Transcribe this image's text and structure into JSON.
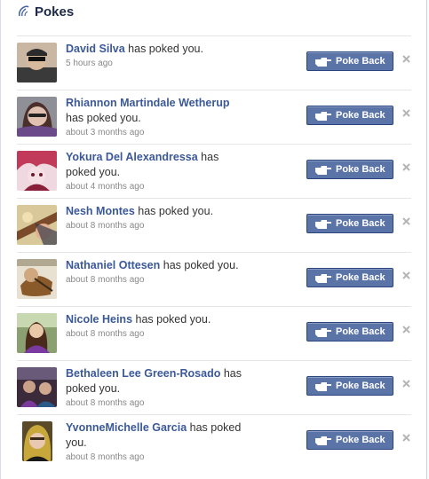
{
  "header": {
    "title": "Pokes",
    "icon": "poke-finger-icon"
  },
  "pokes": [
    {
      "name": "David Silva",
      "action": " has poked you.",
      "time": "5 hours ago",
      "button": "Poke Back"
    },
    {
      "name": "Rhiannon Martindale Wetherup",
      "action": " has poked you.",
      "time": "about 3 months ago",
      "button": "Poke Back"
    },
    {
      "name": "Yokura Del Alexandressa",
      "action": " has poked you.",
      "time": "about 4 months ago",
      "button": "Poke Back"
    },
    {
      "name": "Nesh Montes",
      "action": " has poked you.",
      "time": "about 8 months ago",
      "button": "Poke Back"
    },
    {
      "name": "Nathaniel Ottesen",
      "action": " has poked you.",
      "time": "about 8 months ago",
      "button": "Poke Back"
    },
    {
      "name": "Nicole Heins",
      "action": " has poked you.",
      "time": "about 8 months ago",
      "button": "Poke Back"
    },
    {
      "name": "Bethaleen Lee Green-Rosado",
      "action": " has poked you.",
      "time": "about 8 months ago",
      "button": "Poke Back"
    },
    {
      "name": "YvonneMichelle Garcia",
      "action": " has poked you.",
      "time": "about 8 months ago",
      "button": "Poke Back"
    }
  ],
  "colors": {
    "link": "#3b5998",
    "button": "#5b74a8",
    "button_border": "#29447e"
  }
}
